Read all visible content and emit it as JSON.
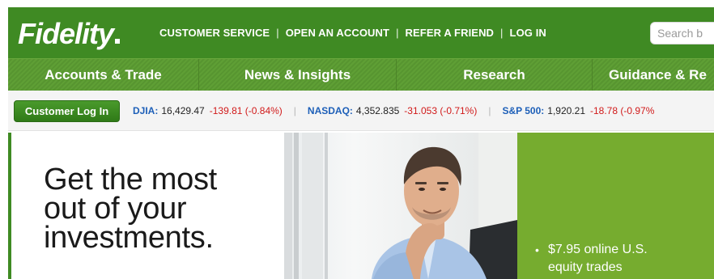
{
  "header": {
    "logo_text": "Fidelity",
    "links": [
      "CUSTOMER SERVICE",
      "OPEN AN ACCOUNT",
      "REFER A FRIEND",
      "LOG IN"
    ],
    "search_placeholder": "Search b",
    "bar_color": "#3f8a23"
  },
  "nav": {
    "items": [
      "Accounts & Trade",
      "News & Insights",
      "Research",
      "Guidance & Re"
    ]
  },
  "ticker": {
    "login_button": "Customer Log In",
    "quotes": [
      {
        "name": "DJIA:",
        "value": "16,429.47",
        "change": "-139.81 (-0.84%)"
      },
      {
        "name": "NASDAQ:",
        "value": "4,352.835",
        "change": "-31.053 (-0.71%)"
      },
      {
        "name": "S&P 500:",
        "value": "1,920.21",
        "change": "-18.78 (-0.97%"
      }
    ]
  },
  "hero": {
    "headline_lines": [
      "Get the most",
      "out of your",
      "investments."
    ],
    "bullets": [
      {
        "line1": "$7.95 online U.S.",
        "line2": "equity trades"
      }
    ],
    "panel_color": "#76ac2f"
  }
}
